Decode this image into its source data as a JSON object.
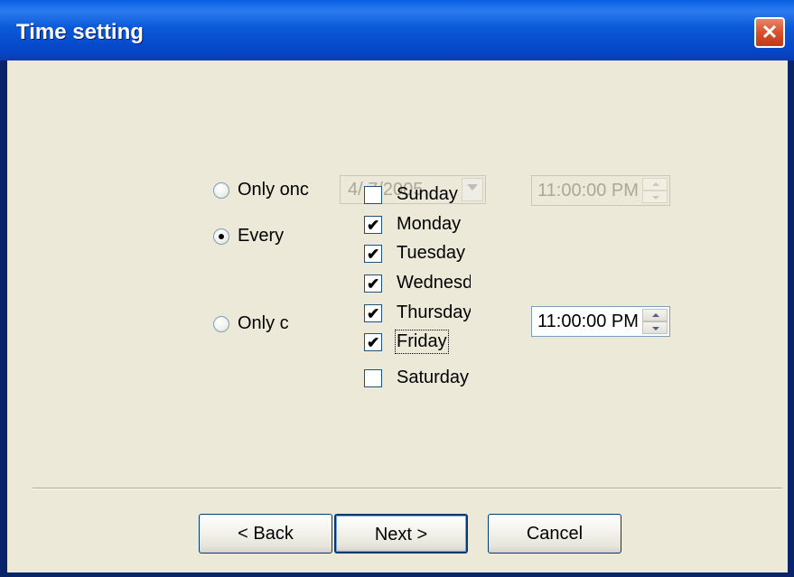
{
  "window": {
    "title": "Time setting",
    "close_glyph": "✕"
  },
  "options": {
    "once": {
      "label": "Only onc",
      "selected": false
    },
    "every": {
      "label": "Every",
      "selected": true
    },
    "only_c": {
      "label": "Only c",
      "selected": false
    }
  },
  "date_combo": {
    "value": "4/  7/2005",
    "enabled": false
  },
  "time_disabled": {
    "value": "11:00:00 PM",
    "enabled": false
  },
  "time_enabled": {
    "value": "11:00:00 PM",
    "enabled": true
  },
  "days": [
    {
      "label": "Sunday",
      "checked": false
    },
    {
      "label": "Monday",
      "checked": true
    },
    {
      "label": "Tuesday",
      "checked": true
    },
    {
      "label": "Wednesday",
      "checked": true
    },
    {
      "label": "Thursday",
      "checked": true
    },
    {
      "label": "Friday",
      "checked": true,
      "focused": true
    },
    {
      "label": "Saturday",
      "checked": false
    }
  ],
  "buttons": {
    "back": "< Back",
    "next": "Next >",
    "cancel": "Cancel"
  },
  "colors": {
    "titlebar": "#0A59D8",
    "dialog_bg": "#ECE9D8",
    "close": "#D8502C",
    "disabled_text": "#ACA899"
  }
}
